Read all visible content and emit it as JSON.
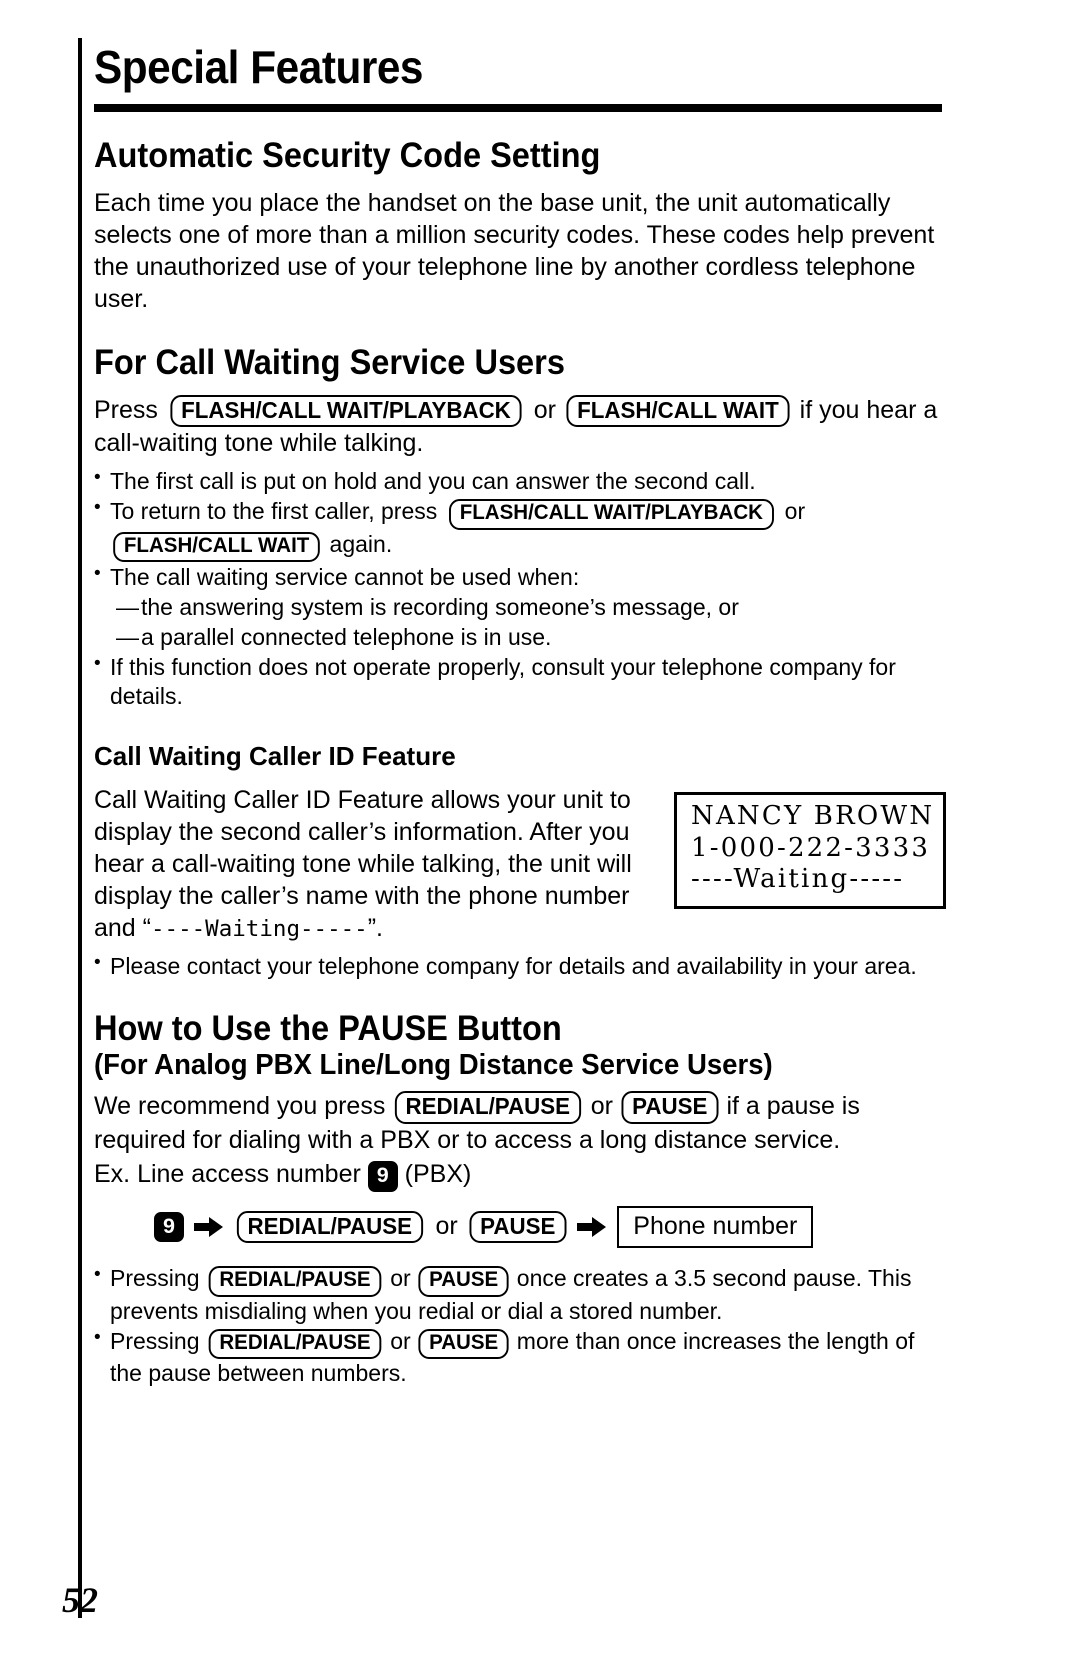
{
  "page": {
    "title": "Special Features",
    "number": "52"
  },
  "sections": {
    "security": {
      "heading": "Automatic Security Code Setting",
      "paragraph": "Each time you place the handset on the base unit, the unit automatically selects one of more than a million security codes. These codes help prevent the unauthorized use of your telephone line by another cordless telephone user."
    },
    "call_waiting": {
      "heading": "For Call Waiting Service Users",
      "intro": {
        "before": "Press ",
        "key1": "FLASH/CALL WAIT/PLAYBACK",
        "middle": " or ",
        "key2": "FLASH/CALL WAIT",
        "after": " if you hear a call-waiting tone while talking."
      },
      "bullets": [
        {
          "text": "The first call is put on hold and you can answer the second call."
        },
        {
          "before": "To return to the first caller, press ",
          "key1": "FLASH/CALL WAIT/PLAYBACK",
          "middle": " or ",
          "key2": "FLASH/CALL WAIT",
          "after": " again."
        },
        {
          "text": "The call waiting service cannot be used when:"
        },
        {
          "dash": true,
          "text": "the answering system is recording someone’s message, or"
        },
        {
          "dash": true,
          "text": "a parallel connected telephone is in use."
        },
        {
          "text": "If this function does not operate properly, consult your telephone company for details."
        }
      ]
    },
    "caller_id": {
      "heading": "Call Waiting Caller ID Feature",
      "paragraph_before": "Call Waiting Caller ID Feature allows your unit to display the second caller’s information. After you hear a call-waiting tone while talking, the unit will display the caller’s name with the phone number and “",
      "paragraph_mono": "----Waiting-----",
      "paragraph_after": "”.",
      "lcd": {
        "line1": "NANCY BROWN",
        "line2": "1-000-222-3333",
        "line3": "----Waiting-----"
      },
      "bullets": [
        {
          "text": "Please contact your telephone company for details and availability in your area."
        }
      ]
    },
    "pause": {
      "heading": "How to Use the PAUSE Button",
      "subheading": "(For Analog PBX Line/Long Distance Service Users)",
      "intro": {
        "before": "We recommend you press ",
        "key1": "REDIAL/PAUSE",
        "middle": " or ",
        "key2": "PAUSE",
        "after": " if a pause is required for dialing with a PBX or to access a long distance service."
      },
      "example": {
        "before": "Ex.  Line access number ",
        "key": "9",
        "after": " (PBX)"
      },
      "flow": {
        "key_num": "9",
        "arrow1": "arrow-right",
        "key1": "REDIAL/PAUSE",
        "or": "or",
        "key2": "PAUSE",
        "arrow2": "arrow-right",
        "box": "Phone number"
      },
      "bullets": [
        {
          "before": "Pressing ",
          "key1": "REDIAL/PAUSE",
          "middle": " or ",
          "key2": "PAUSE",
          "after": " once creates a 3.5 second pause. This prevents misdialing when you redial or dial a stored number."
        },
        {
          "before": "Pressing ",
          "key1": "REDIAL/PAUSE",
          "middle": " or ",
          "key2": "PAUSE",
          "after": " more than once increases the length of the pause between numbers."
        }
      ]
    }
  }
}
